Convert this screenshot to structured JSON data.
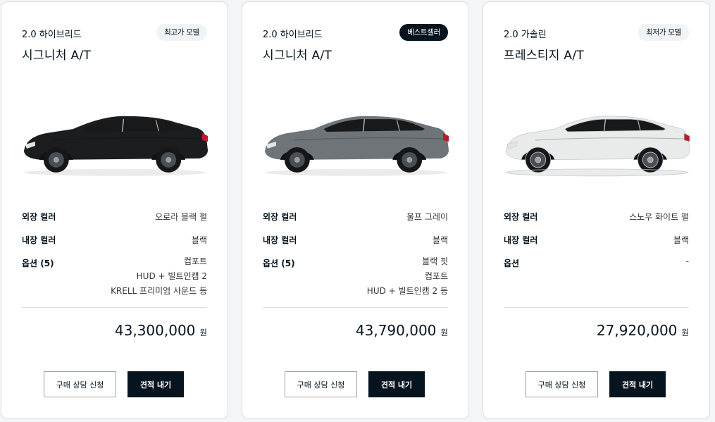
{
  "labels": {
    "exterior": "외장 컬러",
    "interior": "내장 컬러",
    "options_0": "옵션 (5)",
    "options_1": "옵션 (5)",
    "options_2": "옵션",
    "currency": "원",
    "consult_button": "구매 상담 신청",
    "quote_button": "견적 내기"
  },
  "cards": [
    {
      "trim": "2.0 하이브리드",
      "model": "시그니처 A/T",
      "badge": "최고가 모델",
      "exterior_color": "오로라 블랙 펄",
      "interior_color": "블랙",
      "options": [
        "컴포트",
        "HUD + 빌트인캠 2",
        "KRELL 프리미엄 사운드 등"
      ],
      "price": "43,300,000"
    },
    {
      "trim": "2.0 하이브리드",
      "model": "시그니처 A/T",
      "badge": "베스트셀러",
      "exterior_color": "울프 그레이",
      "interior_color": "블랙",
      "options": [
        "블랙 핏",
        "컴포트",
        "HUD + 빌트인캠 2 등"
      ],
      "price": "43,790,000"
    },
    {
      "trim": "2.0 가솔린",
      "model": "프레스티지 A/T",
      "badge": "최저가 모델",
      "exterior_color": "스노우 화이트 펄",
      "interior_color": "블랙",
      "options": [
        "-"
      ],
      "price": "27,920,000"
    }
  ],
  "car_colors": {
    "card_0": "#1c1d1f",
    "card_1": "#6f7478",
    "card_2": "#e9eaea"
  }
}
